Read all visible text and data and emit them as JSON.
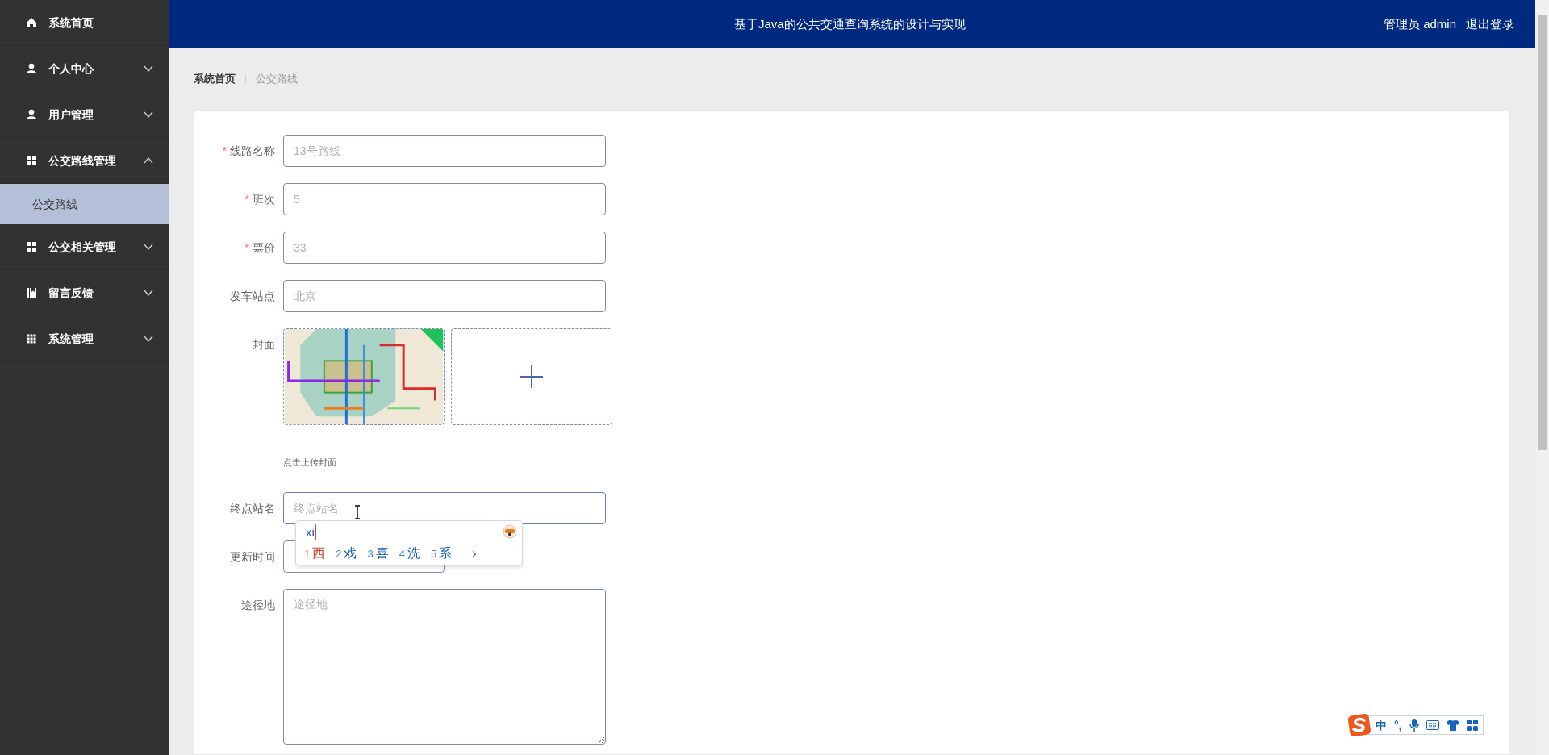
{
  "sidebar": {
    "items": [
      {
        "label": "系统首页"
      },
      {
        "label": "个人中心",
        "expanded": false
      },
      {
        "label": "用户管理",
        "expanded": false
      },
      {
        "label": "公交路线管理",
        "expanded": true,
        "children": [
          {
            "label": "公交路线",
            "selected": true
          }
        ]
      },
      {
        "label": "公交相关管理",
        "expanded": false
      },
      {
        "label": "留言反馈",
        "expanded": false
      },
      {
        "label": "系统管理",
        "expanded": false
      }
    ]
  },
  "header": {
    "title": "基于Java的公共交通查询系统的设计与实现",
    "user": "管理员 admin",
    "logout": "退出登录"
  },
  "breadcrumb": [
    {
      "label": "系统首页",
      "current": false
    },
    {
      "label": "公交路线",
      "current": true
    }
  ],
  "form": {
    "fields": [
      {
        "kind": "input",
        "label": "线路名称",
        "marker": "*",
        "placeholder": "13号路线"
      },
      {
        "kind": "input",
        "label": "班次",
        "marker": "*",
        "placeholder": "5"
      },
      {
        "kind": "input",
        "label": "票价",
        "marker": "*",
        "placeholder": "33"
      },
      {
        "kind": "input",
        "label": "发车站点",
        "placeholder": "北京"
      },
      {
        "kind": "upload",
        "label": "封面",
        "hint": "点击上传封面"
      },
      {
        "kind": "input",
        "label": "终点站名",
        "placeholder": "终点站名",
        "focused": true
      },
      {
        "kind": "date",
        "label": "更新时间"
      },
      {
        "kind": "textarea",
        "label": "途径地",
        "placeholder": "途径地"
      }
    ]
  },
  "ime_popup": {
    "composition": "xi",
    "candidates": [
      {
        "number": "1",
        "text": "西",
        "selected": true
      },
      {
        "number": "2",
        "text": "戏",
        "selected": false
      },
      {
        "number": "3",
        "text": "喜",
        "selected": false
      },
      {
        "number": "4",
        "text": "洗",
        "selected": false
      },
      {
        "number": "5",
        "text": "系",
        "selected": false
      }
    ],
    "next": "›"
  },
  "ime_toolbar": {
    "mode": "中",
    "punctuation": "°,"
  }
}
